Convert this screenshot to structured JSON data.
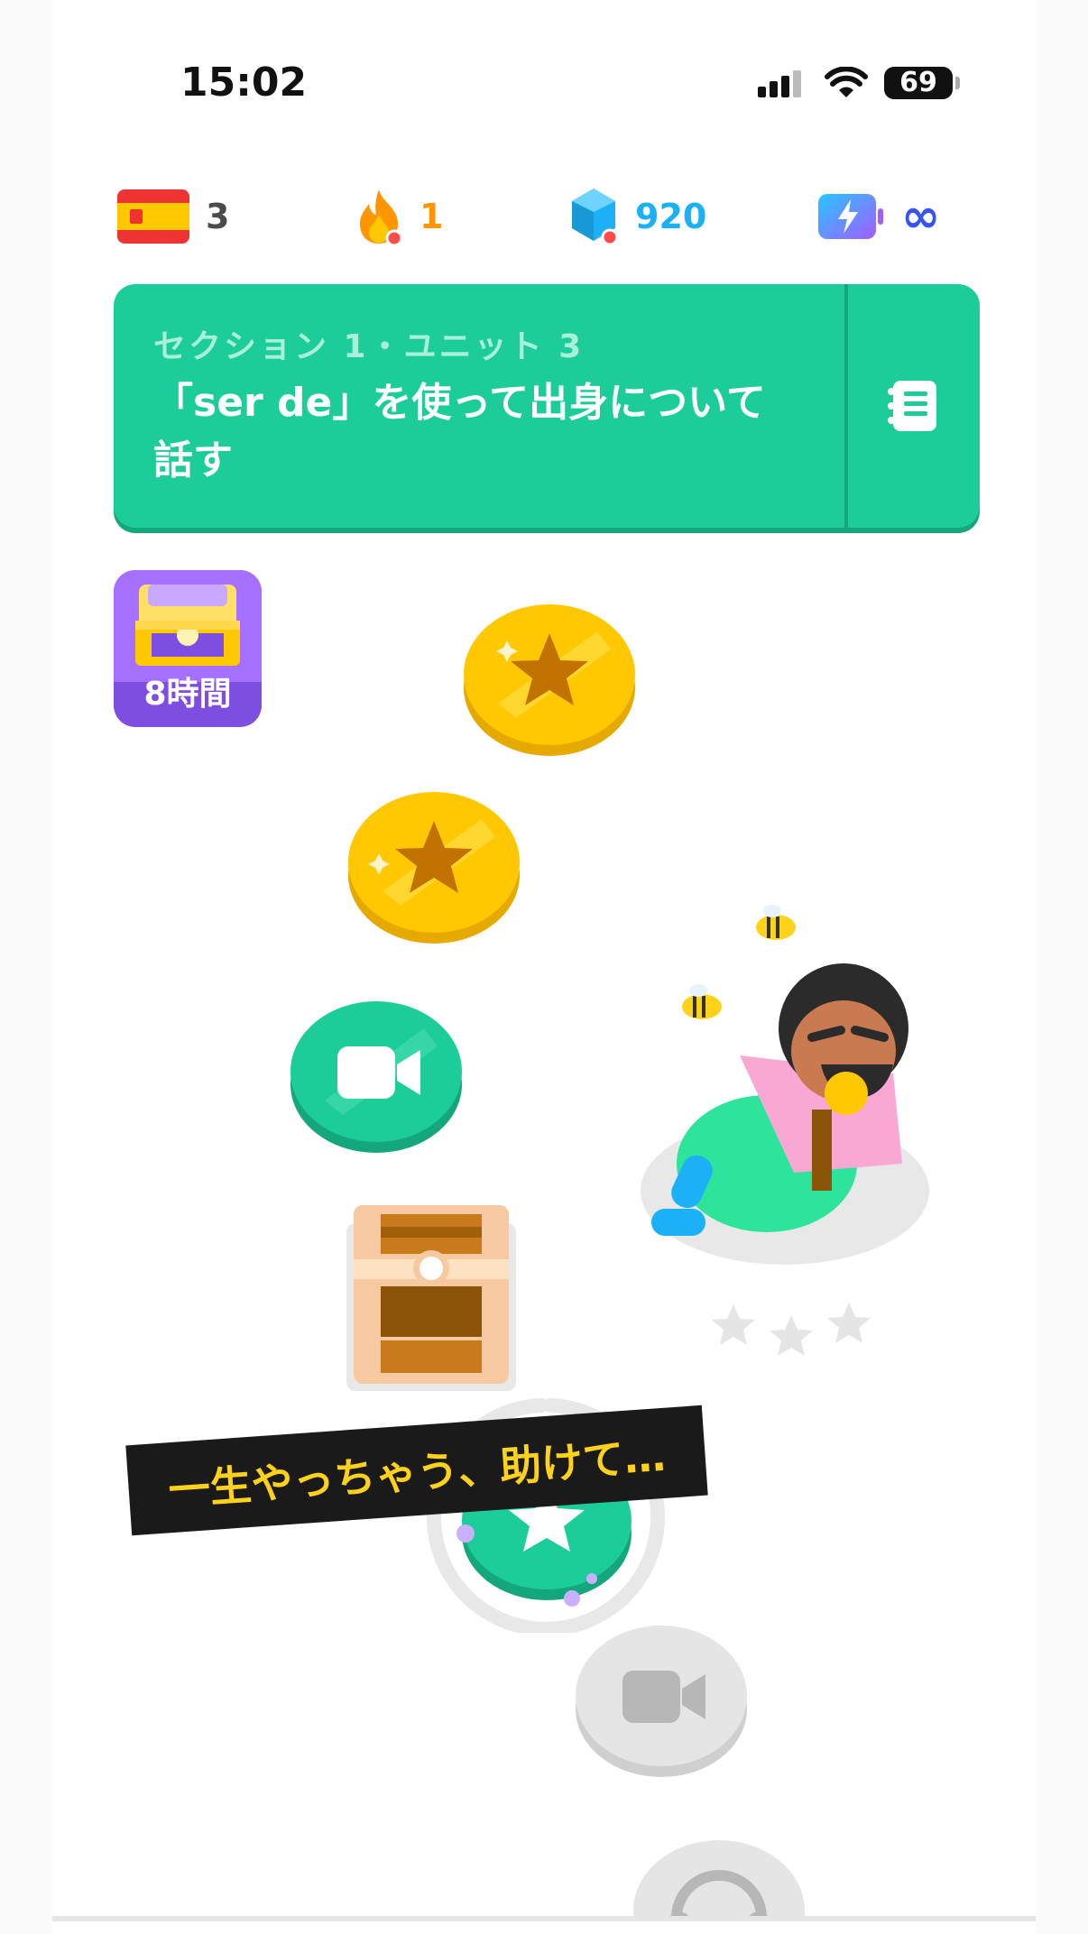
{
  "status_bar": {
    "time": "15:02",
    "battery": "69"
  },
  "stats": {
    "flag_count": "3",
    "streak": "1",
    "gems": "920",
    "energy": "∞"
  },
  "banner": {
    "section": "セクション 1・ユニット 3",
    "title": "「ser de」を使って出身について話す"
  },
  "path": {
    "chest_timer_label": "8時間"
  },
  "caption": "一生やっちゃう、助けて…",
  "colors": {
    "banner_green": "#1ccd99",
    "gold": "#ffc800",
    "gem_blue": "#1cb0f6",
    "streak_orange": "#ff9600",
    "locked_gray": "#e5e5e5"
  }
}
